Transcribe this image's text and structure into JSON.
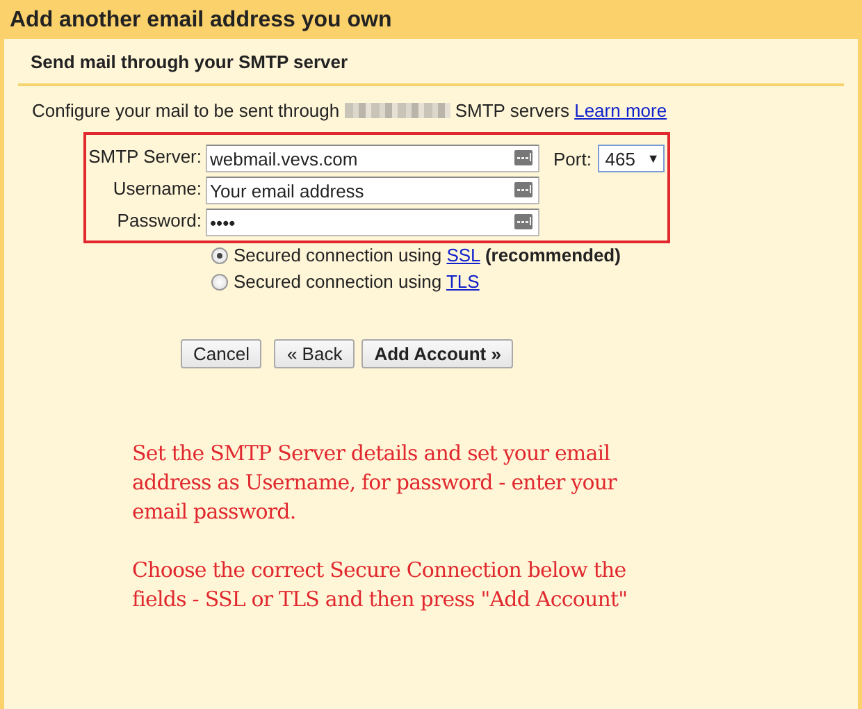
{
  "dialog": {
    "title": "Add another email address you own",
    "subtitle": "Send mail through your SMTP server",
    "intro": {
      "text": "Configure your mail to be sent through",
      "after": "SMTP servers",
      "link": "Learn more"
    },
    "fields": [
      {
        "label": "SMTP Server:",
        "value": "webmail.vevs.com"
      },
      {
        "label": "Username:",
        "value": "Your email address"
      },
      {
        "label": "Password:",
        "value": "••••"
      }
    ],
    "port": {
      "label": "Port:",
      "value": "465",
      "caret": "▼"
    },
    "security": [
      {
        "text": "Secured connection using",
        "link": "SSL",
        "note": "(recommended)",
        "selected": true
      },
      {
        "text": "Secured connection using",
        "link": "TLS",
        "selected": false
      }
    ],
    "buttons": [
      {
        "label": "Cancel",
        "kind": "default"
      },
      {
        "label": "« Back",
        "kind": "default"
      },
      {
        "label": "Add Account »",
        "kind": "primary"
      }
    ],
    "annotation": [
      "Set the SMTP Server details and set your email address as Username, for password - enter your email password.",
      "Choose the correct Secure Connection below the fields - SSL or TLS and then press \"Add Account\""
    ]
  }
}
